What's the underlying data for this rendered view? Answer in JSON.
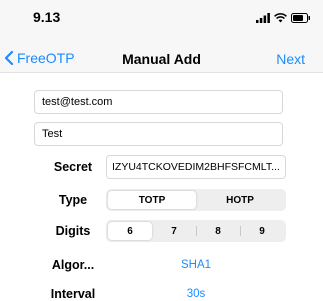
{
  "status": {
    "time": "9.13"
  },
  "nav": {
    "back_label": "FreeOTP",
    "title": "Manual Add",
    "next_label": "Next"
  },
  "form": {
    "issuer": "test@test.com",
    "account": "Test",
    "secret_label": "Secret",
    "secret_value": "IZYU4TCKOVEDIM2BHFSFCMLT...",
    "type_label": "Type",
    "type_options": [
      "TOTP",
      "HOTP"
    ],
    "type_selected": "TOTP",
    "digits_label": "Digits",
    "digits_options": [
      "6",
      "7",
      "8",
      "9"
    ],
    "digits_selected": "6",
    "algorithm_label": "Algor...",
    "algorithm_value": "SHA1",
    "interval_label": "Interval",
    "interval_value": "30s"
  },
  "colors": {
    "accent": "#1a8cff",
    "bar": "#f7f7f7"
  }
}
